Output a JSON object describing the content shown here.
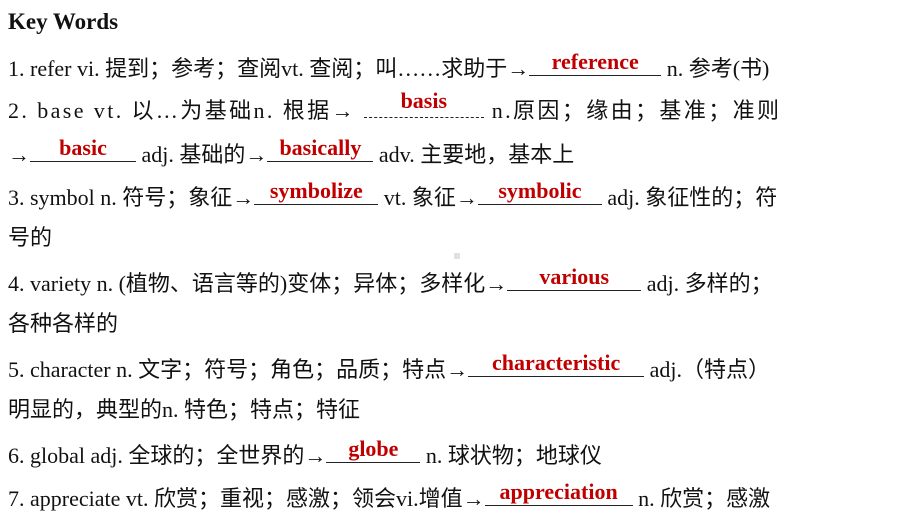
{
  "title": "Key Words",
  "items": [
    {
      "pre": "1. refer vi. 提到；参考；查阅vt. 查阅；叫……求助于→",
      "answer": "reference",
      "post": " n. 参考(书)"
    },
    {
      "pre": "2. base vt. 以…为基础n. 根据→ ",
      "answer": "basis",
      "post": " n.原因；缘由；基准；准则"
    },
    {
      "pre": "→",
      "answer": "basic",
      "mid": " adj. 基础的→",
      "answer2": "basically",
      "post": " adv. 主要地，基本上"
    },
    {
      "pre": "3. symbol n. 符号；象征→",
      "answer": "symbolize",
      "mid": " vt. 象征→",
      "answer2": "symbolic",
      "post": " adj. 象征性的；符"
    },
    {
      "text": "号的"
    },
    {
      "pre": "4. variety n. (植物、语言等的)变体；异体；多样化→",
      "answer": "various",
      "post": " adj. 多样的；"
    },
    {
      "text": "各种各样的"
    },
    {
      "pre": "5. character n. 文字；符号；角色；品质；特点→",
      "answer": "characteristic",
      "post": " adj.（特点）"
    },
    {
      "text": "明显的，典型的n. 特色；特点；特征"
    },
    {
      "pre": "6. global adj. 全球的；全世界的→",
      "answer": "globe",
      "post": " n. 球状物；地球仪"
    },
    {
      "pre": "7. appreciate vt. 欣赏；重视；感激；领会vi.增值→",
      "answer": "appreciation",
      "post": " n. 欣赏；感激"
    }
  ],
  "colors": {
    "answer": "#c00000",
    "text": "#111111"
  }
}
